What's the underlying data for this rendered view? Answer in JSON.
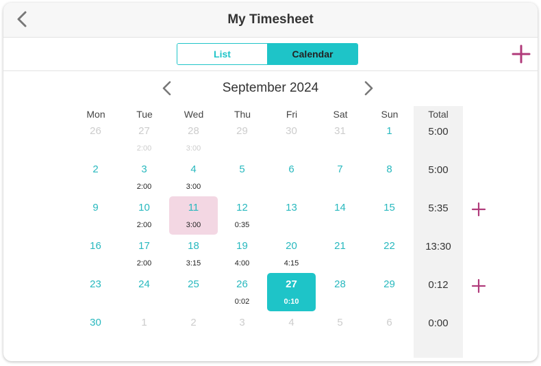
{
  "header": {
    "title": "My Timesheet",
    "back_icon": "chevron-left-icon"
  },
  "toolbar": {
    "list_label": "List",
    "calendar_label": "Calendar",
    "selected": "Calendar",
    "add_icon": "plus-icon"
  },
  "calendar": {
    "month_title": "September 2024",
    "prev_icon": "chevron-left-icon",
    "next_icon": "chevron-right-icon",
    "weekdays": [
      "Mon",
      "Tue",
      "Wed",
      "Thu",
      "Fri",
      "Sat",
      "Sun"
    ],
    "total_header": "Total",
    "weeks": [
      {
        "days": [
          {
            "n": "26",
            "h": "",
            "cur": false
          },
          {
            "n": "27",
            "h": "2:00",
            "cur": false
          },
          {
            "n": "28",
            "h": "3:00",
            "cur": false
          },
          {
            "n": "29",
            "h": "",
            "cur": false
          },
          {
            "n": "30",
            "h": "",
            "cur": false
          },
          {
            "n": "31",
            "h": "",
            "cur": false
          },
          {
            "n": "1",
            "h": "",
            "cur": true
          }
        ],
        "total": "5:00",
        "add": false
      },
      {
        "days": [
          {
            "n": "2",
            "h": "",
            "cur": true
          },
          {
            "n": "3",
            "h": "2:00",
            "cur": true
          },
          {
            "n": "4",
            "h": "3:00",
            "cur": true
          },
          {
            "n": "5",
            "h": "",
            "cur": true
          },
          {
            "n": "6",
            "h": "",
            "cur": true
          },
          {
            "n": "7",
            "h": "",
            "cur": true
          },
          {
            "n": "8",
            "h": "",
            "cur": true
          }
        ],
        "total": "5:00",
        "add": false
      },
      {
        "days": [
          {
            "n": "9",
            "h": "",
            "cur": true
          },
          {
            "n": "10",
            "h": "2:00",
            "cur": true
          },
          {
            "n": "11",
            "h": "3:00",
            "cur": true,
            "hl": true
          },
          {
            "n": "12",
            "h": "0:35",
            "cur": true
          },
          {
            "n": "13",
            "h": "",
            "cur": true
          },
          {
            "n": "14",
            "h": "",
            "cur": true
          },
          {
            "n": "15",
            "h": "",
            "cur": true
          }
        ],
        "total": "5:35",
        "add": true
      },
      {
        "days": [
          {
            "n": "16",
            "h": "",
            "cur": true
          },
          {
            "n": "17",
            "h": "2:00",
            "cur": true
          },
          {
            "n": "18",
            "h": "3:15",
            "cur": true
          },
          {
            "n": "19",
            "h": "4:00",
            "cur": true
          },
          {
            "n": "20",
            "h": "4:15",
            "cur": true
          },
          {
            "n": "21",
            "h": "",
            "cur": true
          },
          {
            "n": "22",
            "h": "",
            "cur": true
          }
        ],
        "total": "13:30",
        "add": false
      },
      {
        "days": [
          {
            "n": "23",
            "h": "",
            "cur": true
          },
          {
            "n": "24",
            "h": "",
            "cur": true
          },
          {
            "n": "25",
            "h": "",
            "cur": true
          },
          {
            "n": "26",
            "h": "0:02",
            "cur": true
          },
          {
            "n": "27",
            "h": "0:10",
            "cur": true,
            "today": true
          },
          {
            "n": "28",
            "h": "",
            "cur": true
          },
          {
            "n": "29",
            "h": "",
            "cur": true
          }
        ],
        "total": "0:12",
        "add": true
      },
      {
        "days": [
          {
            "n": "30",
            "h": "",
            "cur": true
          },
          {
            "n": "1",
            "h": "",
            "cur": false
          },
          {
            "n": "2",
            "h": "",
            "cur": false
          },
          {
            "n": "3",
            "h": "",
            "cur": false
          },
          {
            "n": "4",
            "h": "",
            "cur": false
          },
          {
            "n": "5",
            "h": "",
            "cur": false
          },
          {
            "n": "6",
            "h": "",
            "cur": false
          }
        ],
        "total": "0:00",
        "add": false
      }
    ]
  },
  "colors": {
    "accent": "#1ec4c8",
    "highlight": "#f3d7e3",
    "add": "#b03a7a",
    "day_text": "#27b8be"
  }
}
